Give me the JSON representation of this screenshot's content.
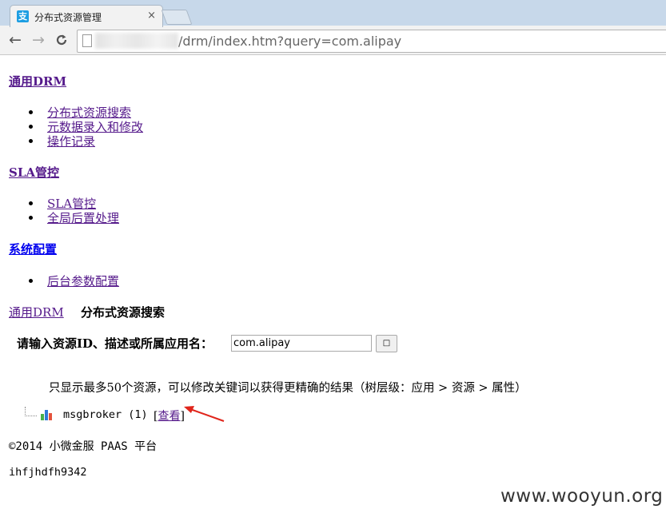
{
  "browser": {
    "tab_title": "分布式资源管理",
    "tab_favicon_text": "支",
    "tab_close": "×",
    "url": "/drm/index.htm?query=com.alipay",
    "back_icon": "←",
    "forward_icon": "→",
    "reload_icon": "C"
  },
  "nav": {
    "sections": [
      {
        "title": "通用DRM",
        "items": [
          "分布式资源搜索",
          "元数据录入和修改",
          "操作记录"
        ]
      },
      {
        "title": "SLA管控",
        "items": [
          "SLA管控",
          "全局后置处理"
        ]
      },
      {
        "title": "系统配置",
        "items": [
          "后台参数配置"
        ]
      }
    ]
  },
  "breadcrumb": {
    "link": "通用DRM",
    "current": "分布式资源搜索"
  },
  "search": {
    "label": "请输入资源ID、描述或所属应用名：",
    "value": "com.alipay",
    "button": "□"
  },
  "hint": "只显示最多50个资源，可以修改关键词以获得更精确的结果（树层级：应用 > 资源 > 属性）",
  "tree": {
    "node_text": "msgbroker (1)",
    "view_open": "[",
    "view_link": "查看",
    "view_close": "]"
  },
  "footer": {
    "copyright": "©2014 小微金服 PAAS 平台",
    "code": "ihfjhdfh9342"
  },
  "watermark": "www.wooyun.org",
  "colors": {
    "visited_link": "#551a8b",
    "link": "#0000ee",
    "annotation_arrow": "#e0251b"
  }
}
